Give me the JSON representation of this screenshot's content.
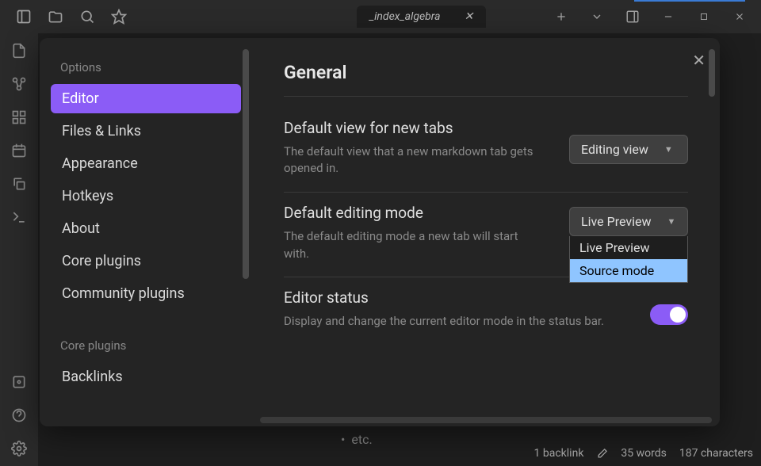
{
  "titlebar": {
    "tab_name": "_index_algebra"
  },
  "sidebar": {
    "section1_heading": "Options",
    "section2_heading": "Core plugins",
    "items": [
      {
        "label": "Editor",
        "active": true
      },
      {
        "label": "Files & Links",
        "active": false
      },
      {
        "label": "Appearance",
        "active": false
      },
      {
        "label": "Hotkeys",
        "active": false
      },
      {
        "label": "About",
        "active": false
      },
      {
        "label": "Core plugins",
        "active": false
      },
      {
        "label": "Community plugins",
        "active": false
      }
    ],
    "core_plugin_items": [
      {
        "label": "Backlinks"
      }
    ]
  },
  "content": {
    "title": "General",
    "settings": [
      {
        "name": "Default view for new tabs",
        "desc": "The default view that a new markdown tab gets opened in.",
        "control_type": "dropdown",
        "value": "Editing view"
      },
      {
        "name": "Default editing mode",
        "desc": "The default editing mode a new tab will start with.",
        "control_type": "dropdown",
        "value": "Live Preview",
        "open": true,
        "options": [
          "Live Preview",
          "Source mode"
        ],
        "highlighted": "Source mode"
      },
      {
        "name": "Editor status",
        "desc": "Display and change the current editor mode in the status bar.",
        "control_type": "toggle",
        "value": true
      }
    ]
  },
  "bg_text": "etc.",
  "statusbar": {
    "backlinks": "1 backlink",
    "words": "35 words",
    "chars": "187 characters"
  }
}
